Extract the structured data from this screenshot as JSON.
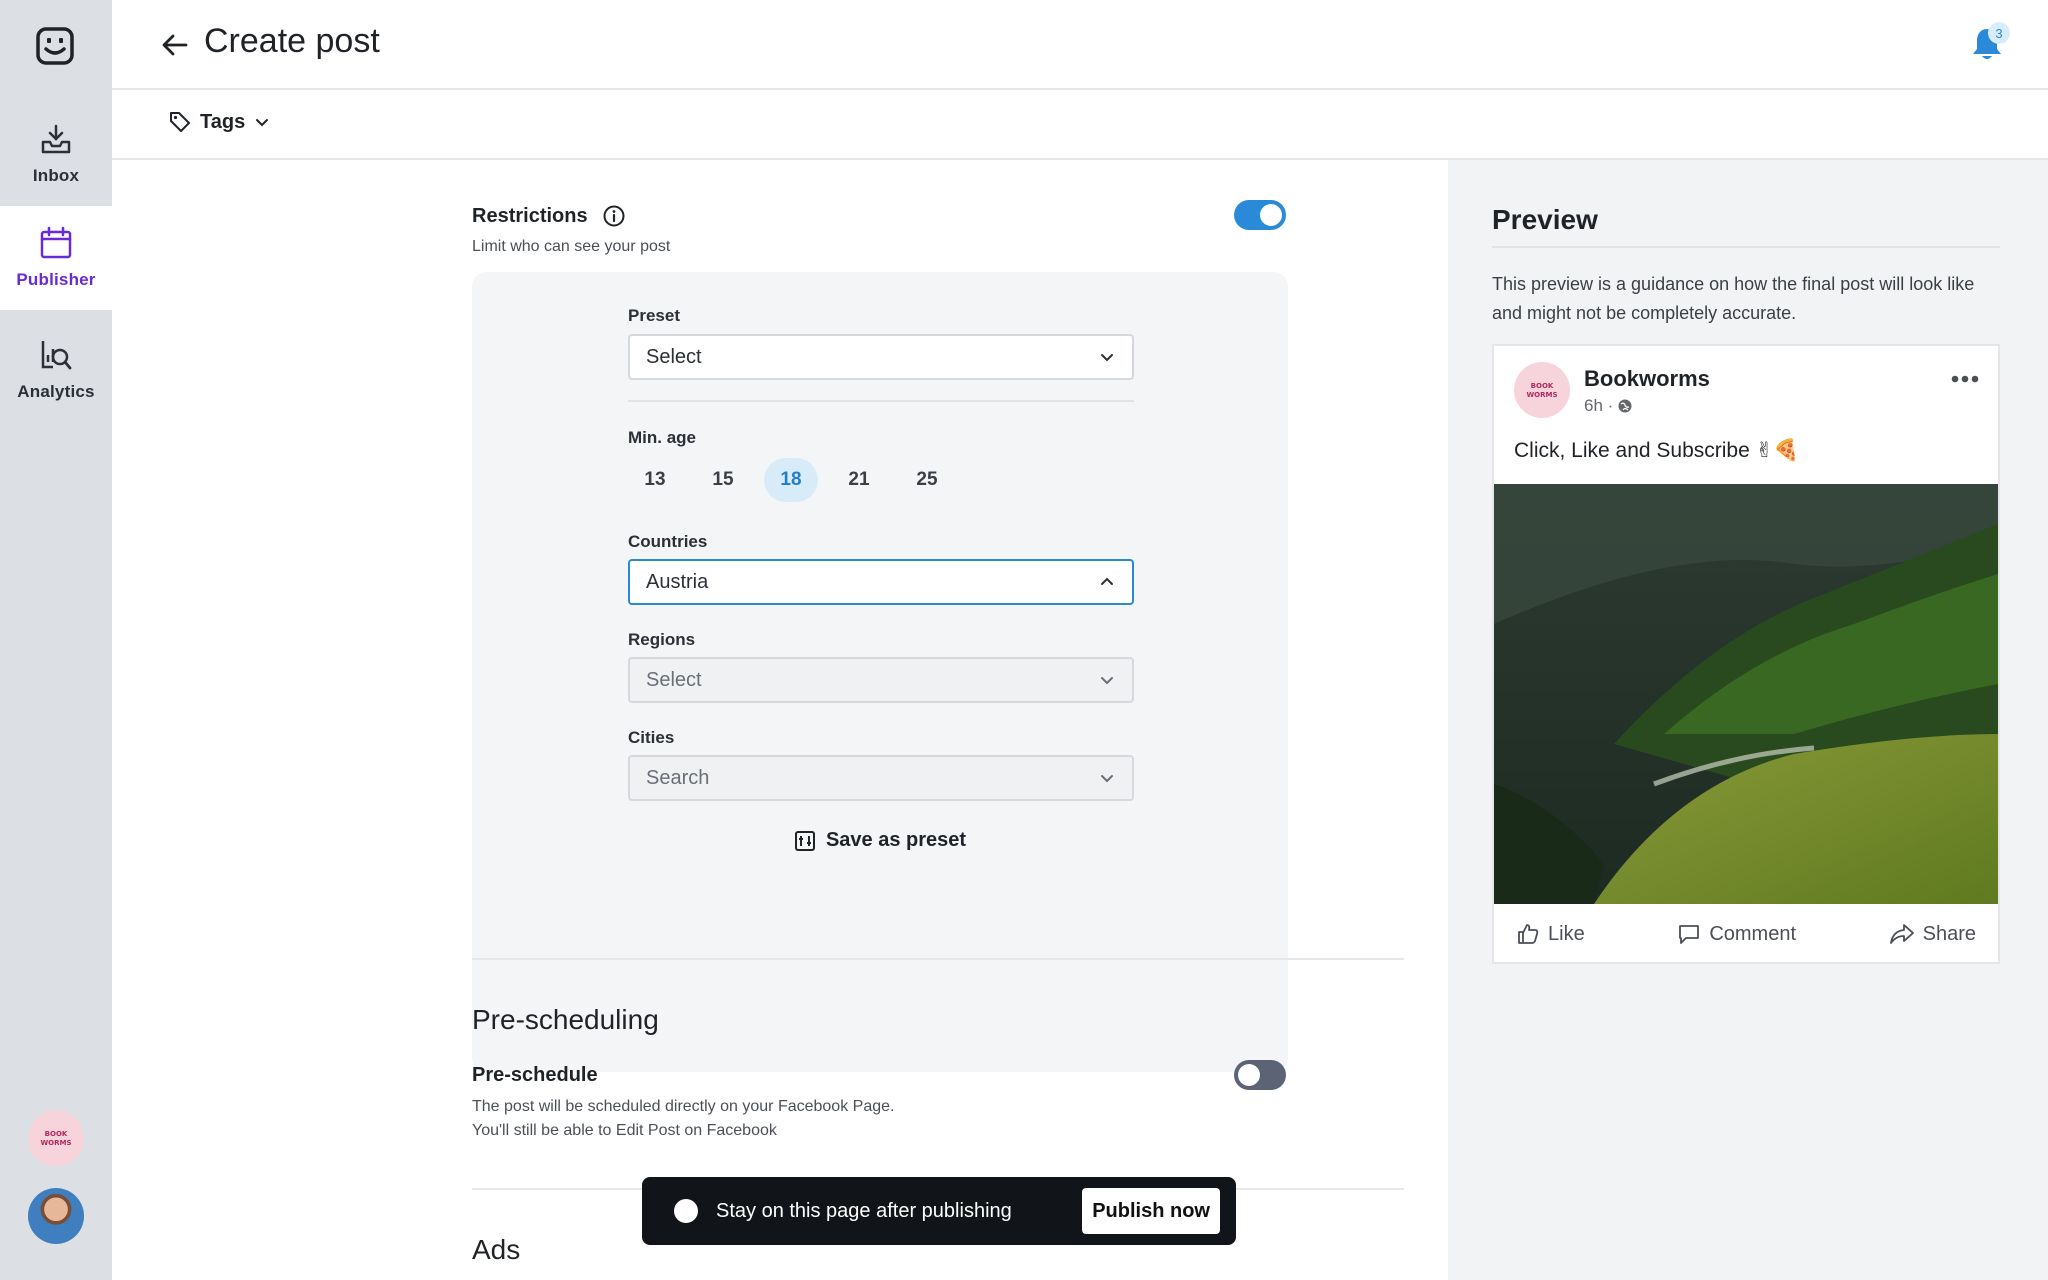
{
  "sidebar": {
    "logo_icon": "smiley-chat-logo",
    "items": [
      {
        "label": "Inbox",
        "icon": "inbox-icon"
      },
      {
        "label": "Publisher",
        "icon": "calendar-icon"
      },
      {
        "label": "Analytics",
        "icon": "analytics-icon"
      }
    ],
    "active": "Publisher",
    "brand_avatar_text": "BOOK WORMS"
  },
  "header": {
    "title": "Create post",
    "notifications_count": "3",
    "tags_label": "Tags"
  },
  "restrictions": {
    "title": "Restrictions",
    "subtitle": "Limit who can see your post",
    "enabled": true,
    "preset": {
      "label": "Preset",
      "value": "Select"
    },
    "min_age": {
      "label": "Min. age",
      "options": [
        "13",
        "15",
        "18",
        "21",
        "25"
      ],
      "selected": "18"
    },
    "countries": {
      "label": "Countries",
      "value": "Austria"
    },
    "regions": {
      "label": "Regions",
      "value": "Select"
    },
    "cities": {
      "label": "Cities",
      "value": "Search"
    },
    "save_preset_label": "Save as preset"
  },
  "prescheduling": {
    "heading": "Pre-scheduling",
    "title": "Pre-schedule",
    "enabled": false,
    "desc_line1": "The post will be scheduled directly on your Facebook Page.",
    "desc_line2": "You'll still be able to Edit Post on Facebook"
  },
  "ads": {
    "heading": "Ads"
  },
  "publish_bar": {
    "stay_label": "Stay on this page after publishing",
    "button_label": "Publish now"
  },
  "preview": {
    "title": "Preview",
    "description": "This preview is a guidance on how the final post will look like and might not be completely accurate.",
    "post": {
      "page_name": "Bookworms",
      "time": "6h ·",
      "text": "Click, Like and Subscribe ✌🍕",
      "avatar_text": "BOOK WORMS",
      "actions": {
        "like": "Like",
        "comment": "Comment",
        "share": "Share"
      }
    }
  },
  "colors": {
    "accent": "#2a8ad8",
    "active_nav": "#6a2ad6",
    "publish_bar": "#111418"
  }
}
